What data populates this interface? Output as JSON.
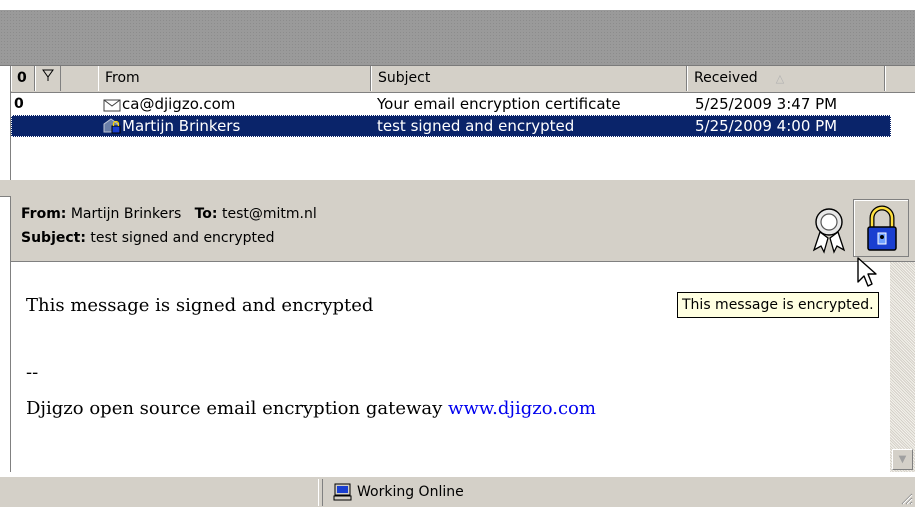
{
  "message_list": {
    "columns": {
      "attachment_header": "0",
      "flag_header": "",
      "from": "From",
      "subject": "Subject",
      "received": "Received",
      "received_sort": "descending"
    },
    "rows": [
      {
        "attachment": "0",
        "from": "ca@djigzo.com",
        "subject": "Your email encryption certificate",
        "received": "5/25/2009 3:47 PM",
        "icon": "envelope-icon",
        "selected": false
      },
      {
        "attachment": "",
        "from": "Martijn Brinkers",
        "subject": "test signed and encrypted",
        "received": "5/25/2009 4:00 PM",
        "icon": "encrypted-message-icon",
        "selected": true
      }
    ]
  },
  "preview": {
    "from_label": "From:",
    "from_value": "Martijn Brinkers",
    "to_label": "To:",
    "to_value": "test@mitm.nl",
    "subject_label": "Subject:",
    "subject_value": "test signed and encrypted",
    "body_line1": "This message is signed and encrypted",
    "signature_dash": "--",
    "signature_text": "Djigzo open source email encryption gateway",
    "signature_link": "www.djigzo.com",
    "cert_icon": "certificate-ribbon-icon",
    "lock_icon": "padlock-icon"
  },
  "tooltip": {
    "text": "This message is encrypted."
  },
  "status_bar": {
    "text": "Working Online",
    "icon": "computer-icon"
  },
  "colors": {
    "selection": "#0a246a",
    "chrome": "#d4d0c8",
    "tooltip_bg": "#ffffe1",
    "link": "#0000ee"
  }
}
